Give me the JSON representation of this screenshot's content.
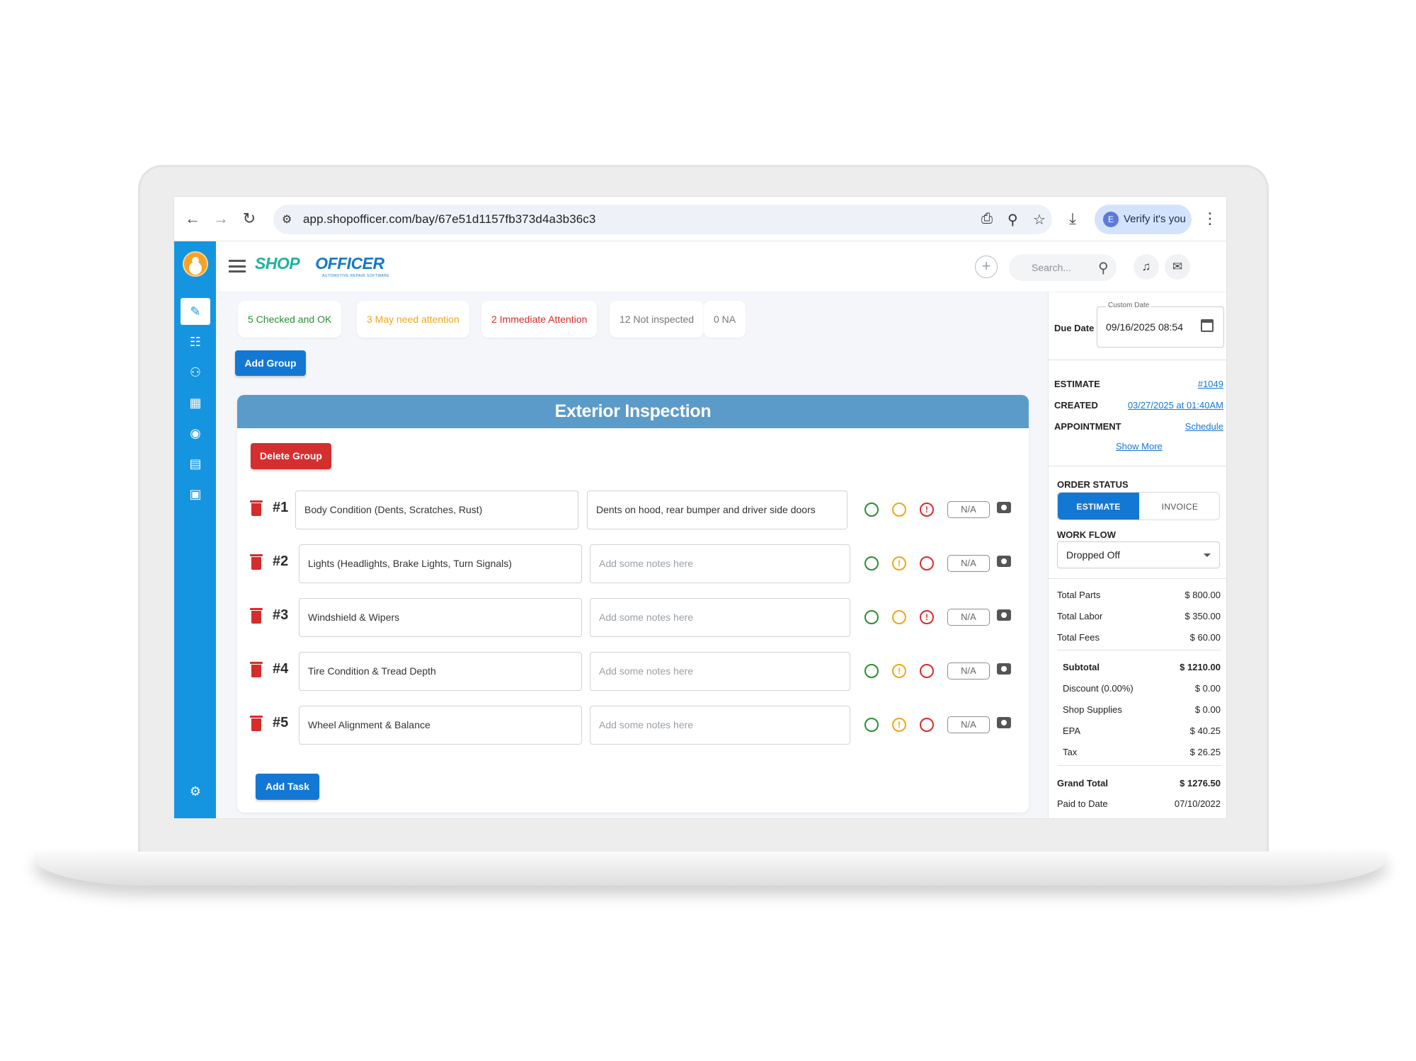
{
  "browser": {
    "url": "app.shopofficer.com/bay/67e51d1157fb373d4a3b36c3",
    "verify_label": "Verify it's you",
    "verify_initial": "E"
  },
  "app": {
    "logo_part1": "SHOP",
    "logo_part2": "OFFICER",
    "logo_sub": "AUTOMOTIVE REPAIR SOFTWARE",
    "search_placeholder": "Search..."
  },
  "summary": {
    "checked": "5 Checked and OK",
    "attention": "3 May need attention",
    "immediate": "2 Immediate Attention",
    "not_inspected": "12 Not inspected",
    "na": "0 NA"
  },
  "colors": {
    "ok": "#27902f",
    "warn": "#f1a414",
    "bad": "#df2a2a",
    "primary": "#1378d3",
    "sidebar": "#1595e0"
  },
  "buttons": {
    "add_group": "Add Group",
    "delete_group": "Delete Group",
    "add_task": "Add Task"
  },
  "group": {
    "title": "Exterior Inspection",
    "tasks": [
      {
        "number": "#1",
        "name": "Body Condition (Dents, Scratches, Rust)",
        "note": "Dents on hood, rear bumper and driver side doors",
        "status": "bad",
        "na": "N/A"
      },
      {
        "number": "#2",
        "name": "Lights (Headlights, Brake Lights, Turn Signals)",
        "note": "",
        "status": "warn",
        "na": "N/A"
      },
      {
        "number": "#3",
        "name": "Windshield & Wipers",
        "note": "",
        "status": "bad",
        "na": "N/A"
      },
      {
        "number": "#4",
        "name": "Tire Condition & Tread Depth",
        "note": "",
        "status": "warn",
        "na": "N/A"
      },
      {
        "number": "#5",
        "name": "Wheel Alignment & Balance",
        "note": "",
        "status": "warn",
        "na": "N/A"
      }
    ],
    "note_placeholder": "Add some notes here"
  },
  "order": {
    "due_date_label": "Due Date",
    "custom_date_legend": "Custom Date",
    "due_date_value": "09/16/2025 08:54",
    "estimate_label": "ESTIMATE",
    "estimate_value": "#1049",
    "created_label": "CREATED",
    "created_value": "03/27/2025 at 01:40AM",
    "appointment_label": "APPOINTMENT",
    "appointment_value": "Schedule",
    "show_more": "Show More",
    "order_status_label": "ORDER STATUS",
    "status_estimate": "ESTIMATE",
    "status_invoice": "INVOICE",
    "workflow_label": "WORK FLOW",
    "workflow_value": "Dropped Off"
  },
  "totals": {
    "total_parts_label": "Total Parts",
    "total_parts": "$ 800.00",
    "total_labor_label": "Total Labor",
    "total_labor": "$ 350.00",
    "total_fees_label": "Total Fees",
    "total_fees": "$ 60.00",
    "subtotal_label": "Subtotal",
    "subtotal": "$ 1210.00",
    "discount_label": "Discount (0.00%)",
    "discount": "$ 0.00",
    "shop_supplies_label": "Shop Supplies",
    "shop_supplies": "$ 0.00",
    "epa_label": "EPA",
    "epa": "$ 40.25",
    "tax_label": "Tax",
    "tax": "$ 26.25",
    "grand_total_label": "Grand Total",
    "grand_total": "$ 1276.50",
    "paid_to_date_label": "Paid to Date",
    "paid_to_date": "07/10/2022"
  }
}
